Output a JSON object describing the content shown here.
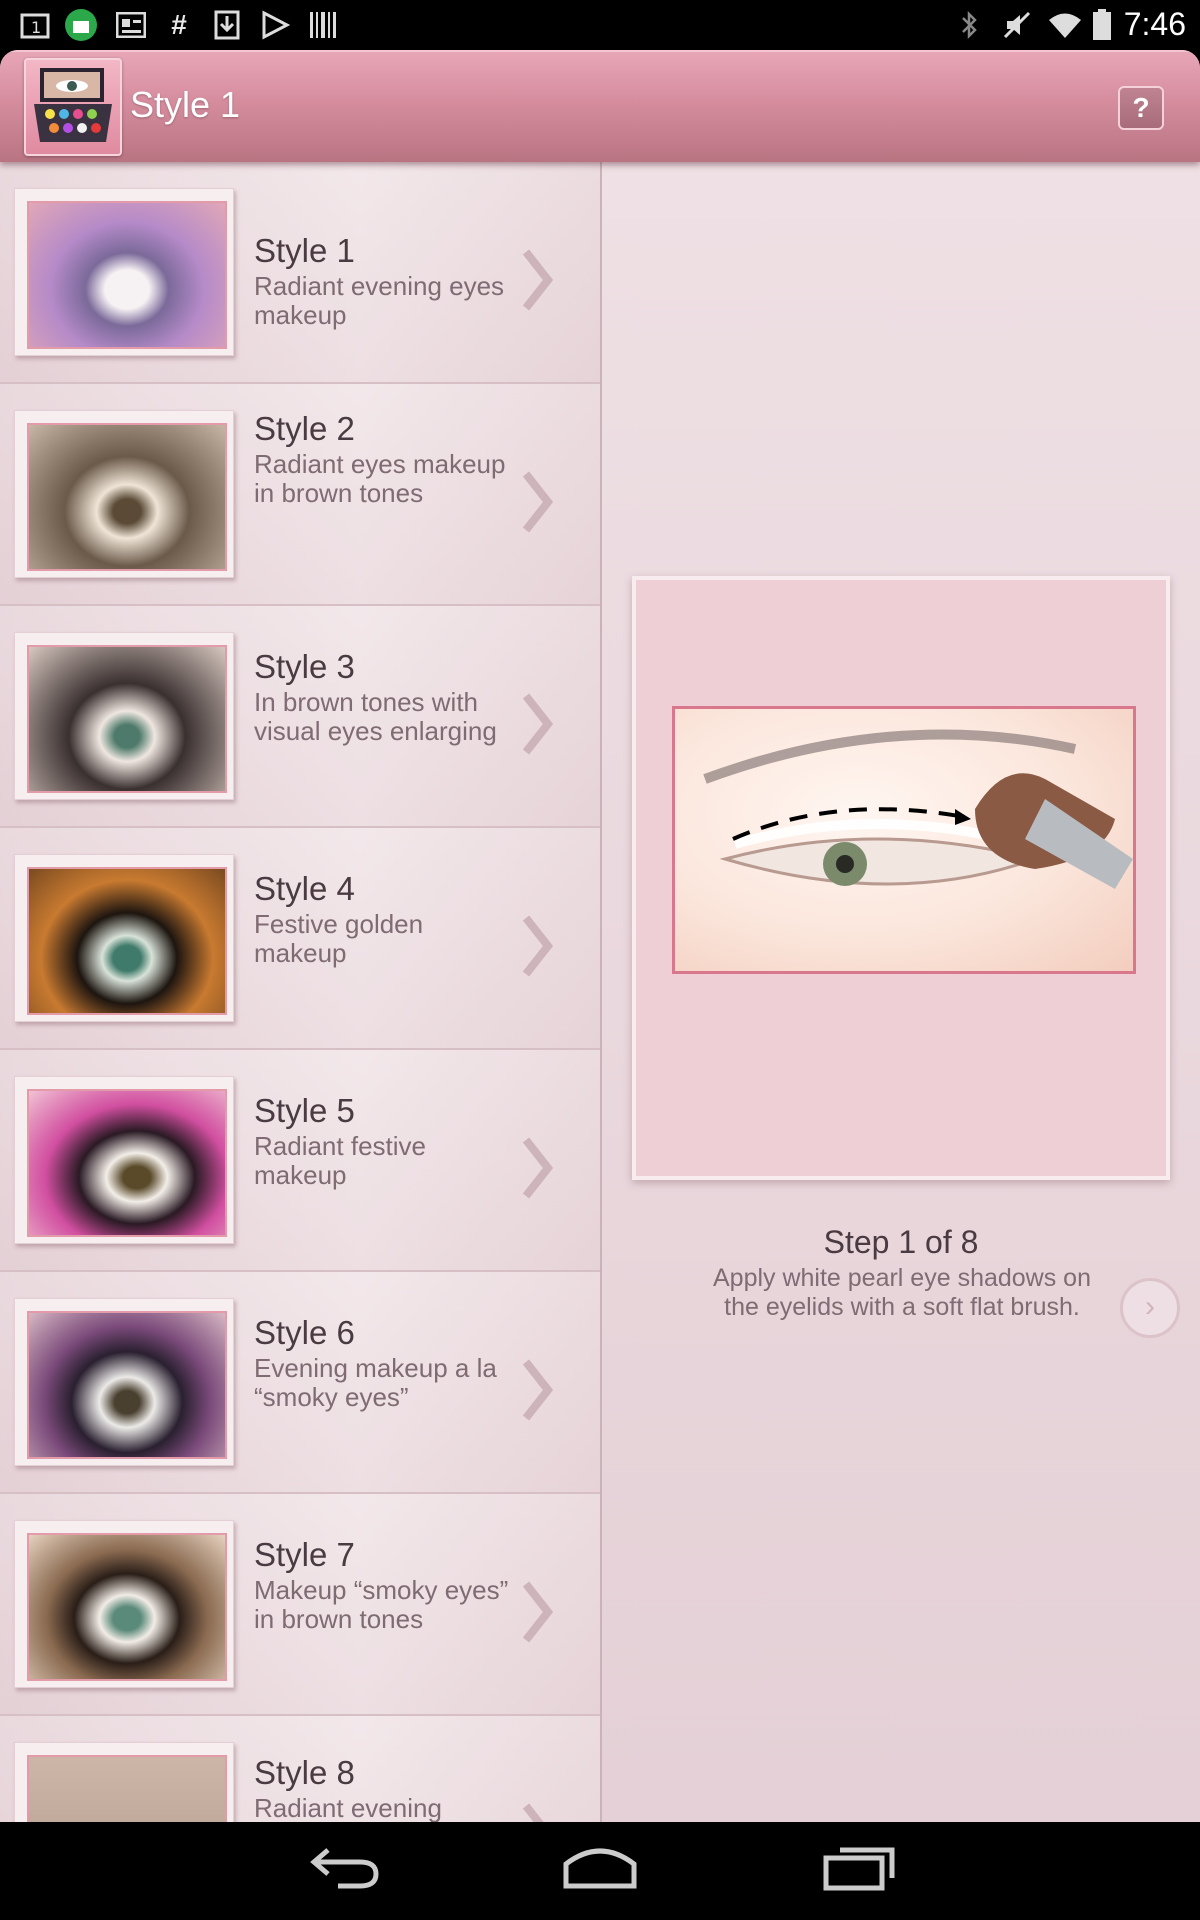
{
  "status_bar": {
    "time": "7:46"
  },
  "action_bar": {
    "title": "Style 1",
    "help_label": "?"
  },
  "styles": [
    {
      "title": "Style 1",
      "subtitle": "Radiant evening eyes makeup"
    },
    {
      "title": "Style 2",
      "subtitle": "Radiant eyes makeup in brown tones"
    },
    {
      "title": "Style 3",
      "subtitle": "In brown tones with visual eyes enlarging"
    },
    {
      "title": "Style 4",
      "subtitle": "Festive golden makeup"
    },
    {
      "title": "Style 5",
      "subtitle": "Radiant festive makeup"
    },
    {
      "title": "Style 6",
      "subtitle": "Evening makeup a la “smoky eyes”"
    },
    {
      "title": "Style 7",
      "subtitle": "Makeup “smoky eyes” in brown tones"
    },
    {
      "title": "Style 8",
      "subtitle": "Radiant evening"
    }
  ],
  "detail": {
    "step_label": "Step 1 of 8",
    "step_description": "Apply white pearl eye shadows on the eyelids with a soft flat brush.",
    "next_label": "›"
  },
  "colors": {
    "action_bar": "#d58d9e",
    "accent_border": "#d9788d"
  }
}
